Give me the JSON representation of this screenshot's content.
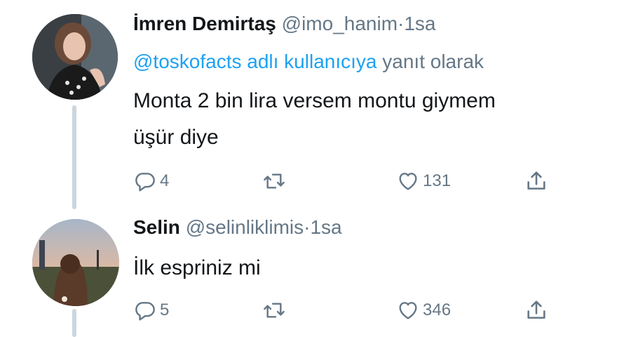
{
  "tweets": [
    {
      "display_name": "İmren Demirtaş",
      "handle": "@imo_hanim",
      "separator": "·",
      "time": "1sa",
      "reply_to_handle": "@toskofacts adlı kullanıcıya",
      "reply_to_suffix": "yanıt olarak",
      "text_lines": [
        "Monta 2 bin lira versem montu giymem",
        "üşür diye"
      ],
      "replies": "4",
      "likes": "131",
      "icons": [
        "reply-icon",
        "retweet-icon",
        "heart-icon",
        "share-icon"
      ]
    },
    {
      "display_name": "Selin",
      "handle": "@selinliklimis",
      "separator": "·",
      "time": "1sa",
      "text_lines": [
        "İlk espriniz mi"
      ],
      "replies": "5",
      "likes": "346",
      "icons": [
        "reply-icon",
        "retweet-icon",
        "heart-icon",
        "share-icon"
      ]
    }
  ],
  "colors": {
    "text": "#14171a",
    "muted": "#657786",
    "link": "#1da1f2",
    "thread_line": "#ccd6dd"
  }
}
